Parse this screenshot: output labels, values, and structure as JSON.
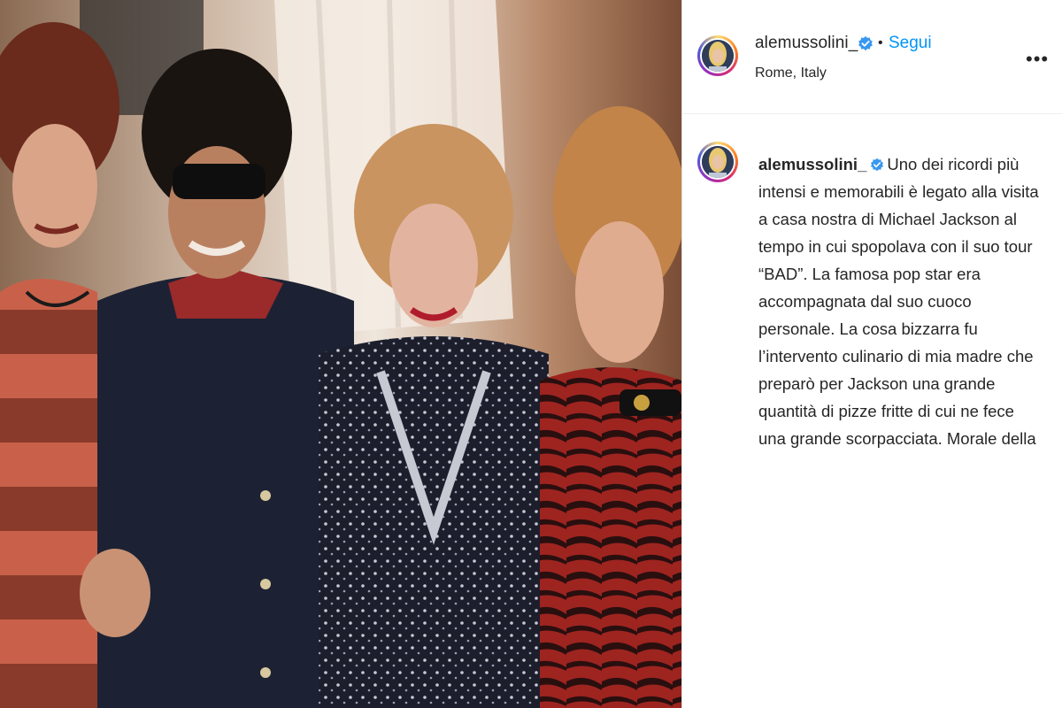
{
  "post": {
    "header": {
      "username": "alemussolini_",
      "separator": "•",
      "follow_label": "Segui",
      "location": "Rome, Italy",
      "more_label": "•••"
    },
    "caption": {
      "username": "alemussolini_",
      "text": "Uno dei ricordi più intensi e memorabili è legato alla visita a casa nostra di Michael Jackson al tempo in cui spopolava con il suo tour “BAD”. La famosa pop star era accompagnata dal suo cuoco personale. La cosa bizzarra fu l’intervento culinario di mia madre che preparò per Jackson una grande quantità di pizze fritte di cui ne fece una grande scorpacciata. Morale della"
    },
    "photo": {
      "icon": "vintage-group-photo"
    },
    "colors": {
      "link_blue": "#0095f6",
      "verified_blue": "#3897f0",
      "text": "#262626"
    }
  }
}
